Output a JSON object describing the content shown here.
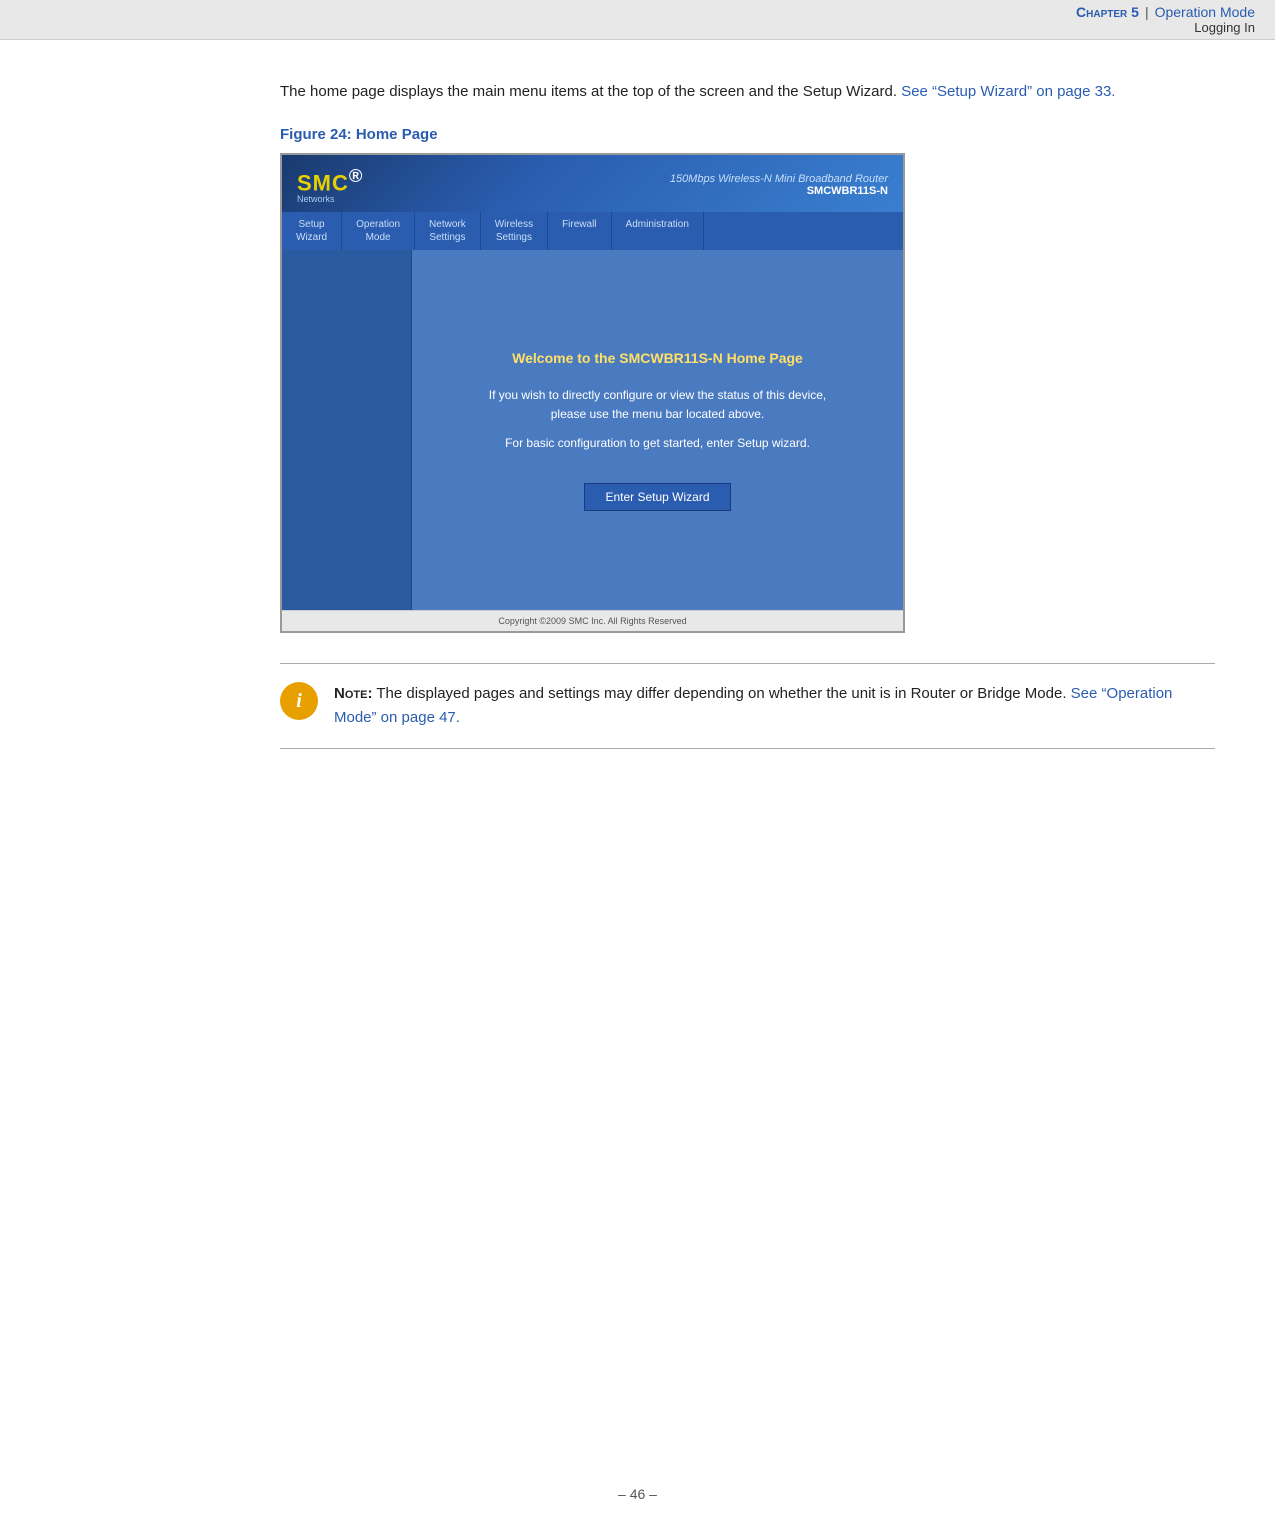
{
  "header": {
    "chapter_label": "Chapter 5",
    "pipe": "|",
    "link_text": "Operation Mode",
    "subtitle": "Logging In"
  },
  "content": {
    "intro": {
      "text": "The home page displays the main menu items at the top of the screen and the Setup Wizard. ",
      "link_text": "See “Setup Wizard” on page 33."
    },
    "figure_title": "Figure 24:  Home Page",
    "router_ui": {
      "logo": "SMC",
      "logo_registered": "®",
      "tagline": "Networks",
      "product_name": "150Mbps Wireless-N Mini Broadband Router",
      "model": "SMCWBR11S-N",
      "nav_items": [
        {
          "line1": "Setup",
          "line2": "Wizard"
        },
        {
          "line1": "Operation",
          "line2": "Mode"
        },
        {
          "line1": "Network",
          "line2": "Settings"
        },
        {
          "line1": "Wireless",
          "line2": "Settings"
        },
        {
          "line1": "Firewall",
          "line2": ""
        },
        {
          "line1": "Administration",
          "line2": ""
        }
      ],
      "welcome_title": "Welcome to the SMCWBR11S-N Home Page",
      "welcome_line1": "If you wish to directly configure or view the status of this device,",
      "welcome_line2": "please use the menu bar located above.",
      "welcome_line3": "For basic configuration to get started, enter Setup wizard.",
      "setup_button": "Enter Setup Wizard",
      "footer": "Copyright ©2009 SMC Inc. All Rights Reserved"
    },
    "note": {
      "label": "Note:",
      "text": " The displayed pages and settings may differ depending on whether the unit is in Router or Bridge Mode. ",
      "link_text": "See “Operation Mode” on page 47."
    }
  },
  "page_footer": {
    "text": "–  46  –"
  }
}
